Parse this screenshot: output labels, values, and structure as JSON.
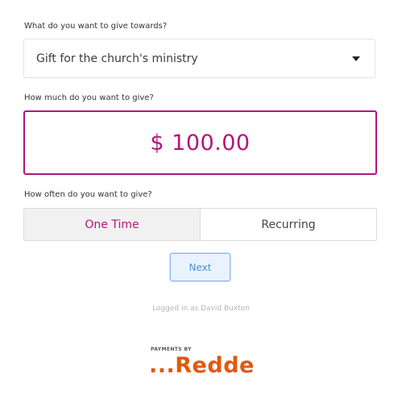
{
  "labels": {
    "give_towards": "What do you want to give towards?",
    "how_much": "How much do you want to give?",
    "how_often": "How often do you want to give?"
  },
  "fund_select": {
    "value": "Gift for the church's ministry",
    "icon": "caret-down-icon"
  },
  "amount": {
    "value": "$ 100.00"
  },
  "frequency": {
    "options": [
      "One Time",
      "Recurring"
    ],
    "selected": "One Time"
  },
  "next_button": "Next",
  "logged_in": "Logged in as David Buxton",
  "footer": {
    "payments_by": "PAYMENTS BY",
    "brand": "...Redde",
    "trademark": "™"
  },
  "colors": {
    "accent": "#b3157a",
    "brand": "#e0590f",
    "button": "#4a90d9"
  }
}
